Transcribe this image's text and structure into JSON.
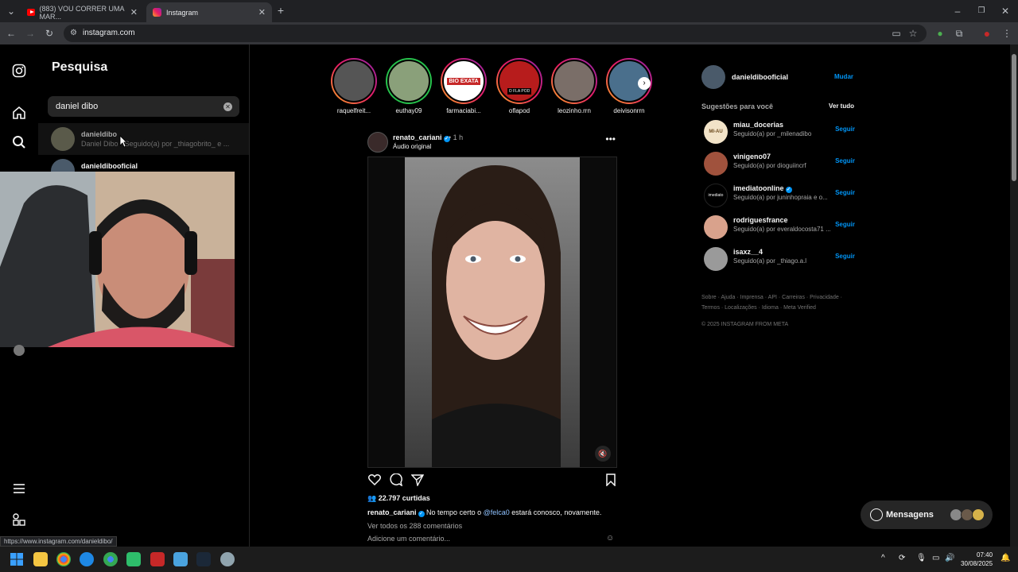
{
  "browser": {
    "tabs": [
      {
        "label": "(883) VOU CORRER UMA MAR...",
        "icon": "youtube-icon"
      },
      {
        "label": "Instagram",
        "icon": "instagram-icon"
      }
    ],
    "url": "instagram.com",
    "status_url": "https://www.instagram.com/danieldibo/"
  },
  "search": {
    "title": "Pesquisa",
    "query": "daniel dibo",
    "results": [
      {
        "username": "danieldibo",
        "subtitle": "Daniel Dibo • Seguido(a) por _thiagobrito_ e ..."
      },
      {
        "username": "danieldibooficial",
        "subtitle": ""
      }
    ]
  },
  "stories": [
    {
      "username": "raquelfreit..."
    },
    {
      "username": "euthay09"
    },
    {
      "username": "farmaciabi...",
      "logo_text": "BIO EXATA"
    },
    {
      "username": "oflapod",
      "logo_text": "O FLA POD"
    },
    {
      "username": "leozinho.rrn"
    },
    {
      "username": "deivisonrrn"
    }
  ],
  "post": {
    "username": "renato_cariani",
    "time": "• 1 h",
    "audio": "Áudio original",
    "likes": "22.797 curtidas",
    "caption_user": "renato_cariani",
    "caption_text_1": "No tempo certo o",
    "caption_mention": "@felca0",
    "caption_text_2": "estará conosco, novamente.",
    "comments_link": "Ver todos os 288 comentários",
    "add_comment": "Adicione um comentário..."
  },
  "sidebar_right": {
    "current_user": "danieldibooficial",
    "switch_label": "Mudar",
    "suggestions_title": "Sugestões para você",
    "see_all": "Ver tudo",
    "suggestions": [
      {
        "username": "miau_docerias",
        "subtitle": "Seguido(a) por _milenadibo",
        "action": "Seguir",
        "logo_text": "MI-AU"
      },
      {
        "username": "vinigeno07",
        "subtitle": "Seguido(a) por dioguiincrf",
        "action": "Seguir"
      },
      {
        "username": "imediatoonline",
        "subtitle": "Seguido(a) por juninhopraia e o...",
        "action": "Seguir",
        "verified": true,
        "logo_text": "imediato"
      },
      {
        "username": "rodriguesfrance",
        "subtitle": "Seguido(a) por everaldocosta71 ...",
        "action": "Seguir"
      },
      {
        "username": "isaxz__4",
        "subtitle": "Seguido(a) por _thiago.a.l",
        "action": "Seguir"
      }
    ],
    "footer_line_1": "Sobre · Ajuda · Imprensa · API · Carreiras · Privacidade ·",
    "footer_line_2": "Termos · Localizações · Idioma · Meta Verified",
    "copyright": "© 2025 INSTAGRAM FROM META"
  },
  "messages": {
    "label": "Mensagens"
  },
  "taskbar": {
    "time": "07:40",
    "date": "30/08/2025"
  },
  "colors": {
    "accent": "#0095f6",
    "background": "#000000",
    "panel": "#262626"
  }
}
